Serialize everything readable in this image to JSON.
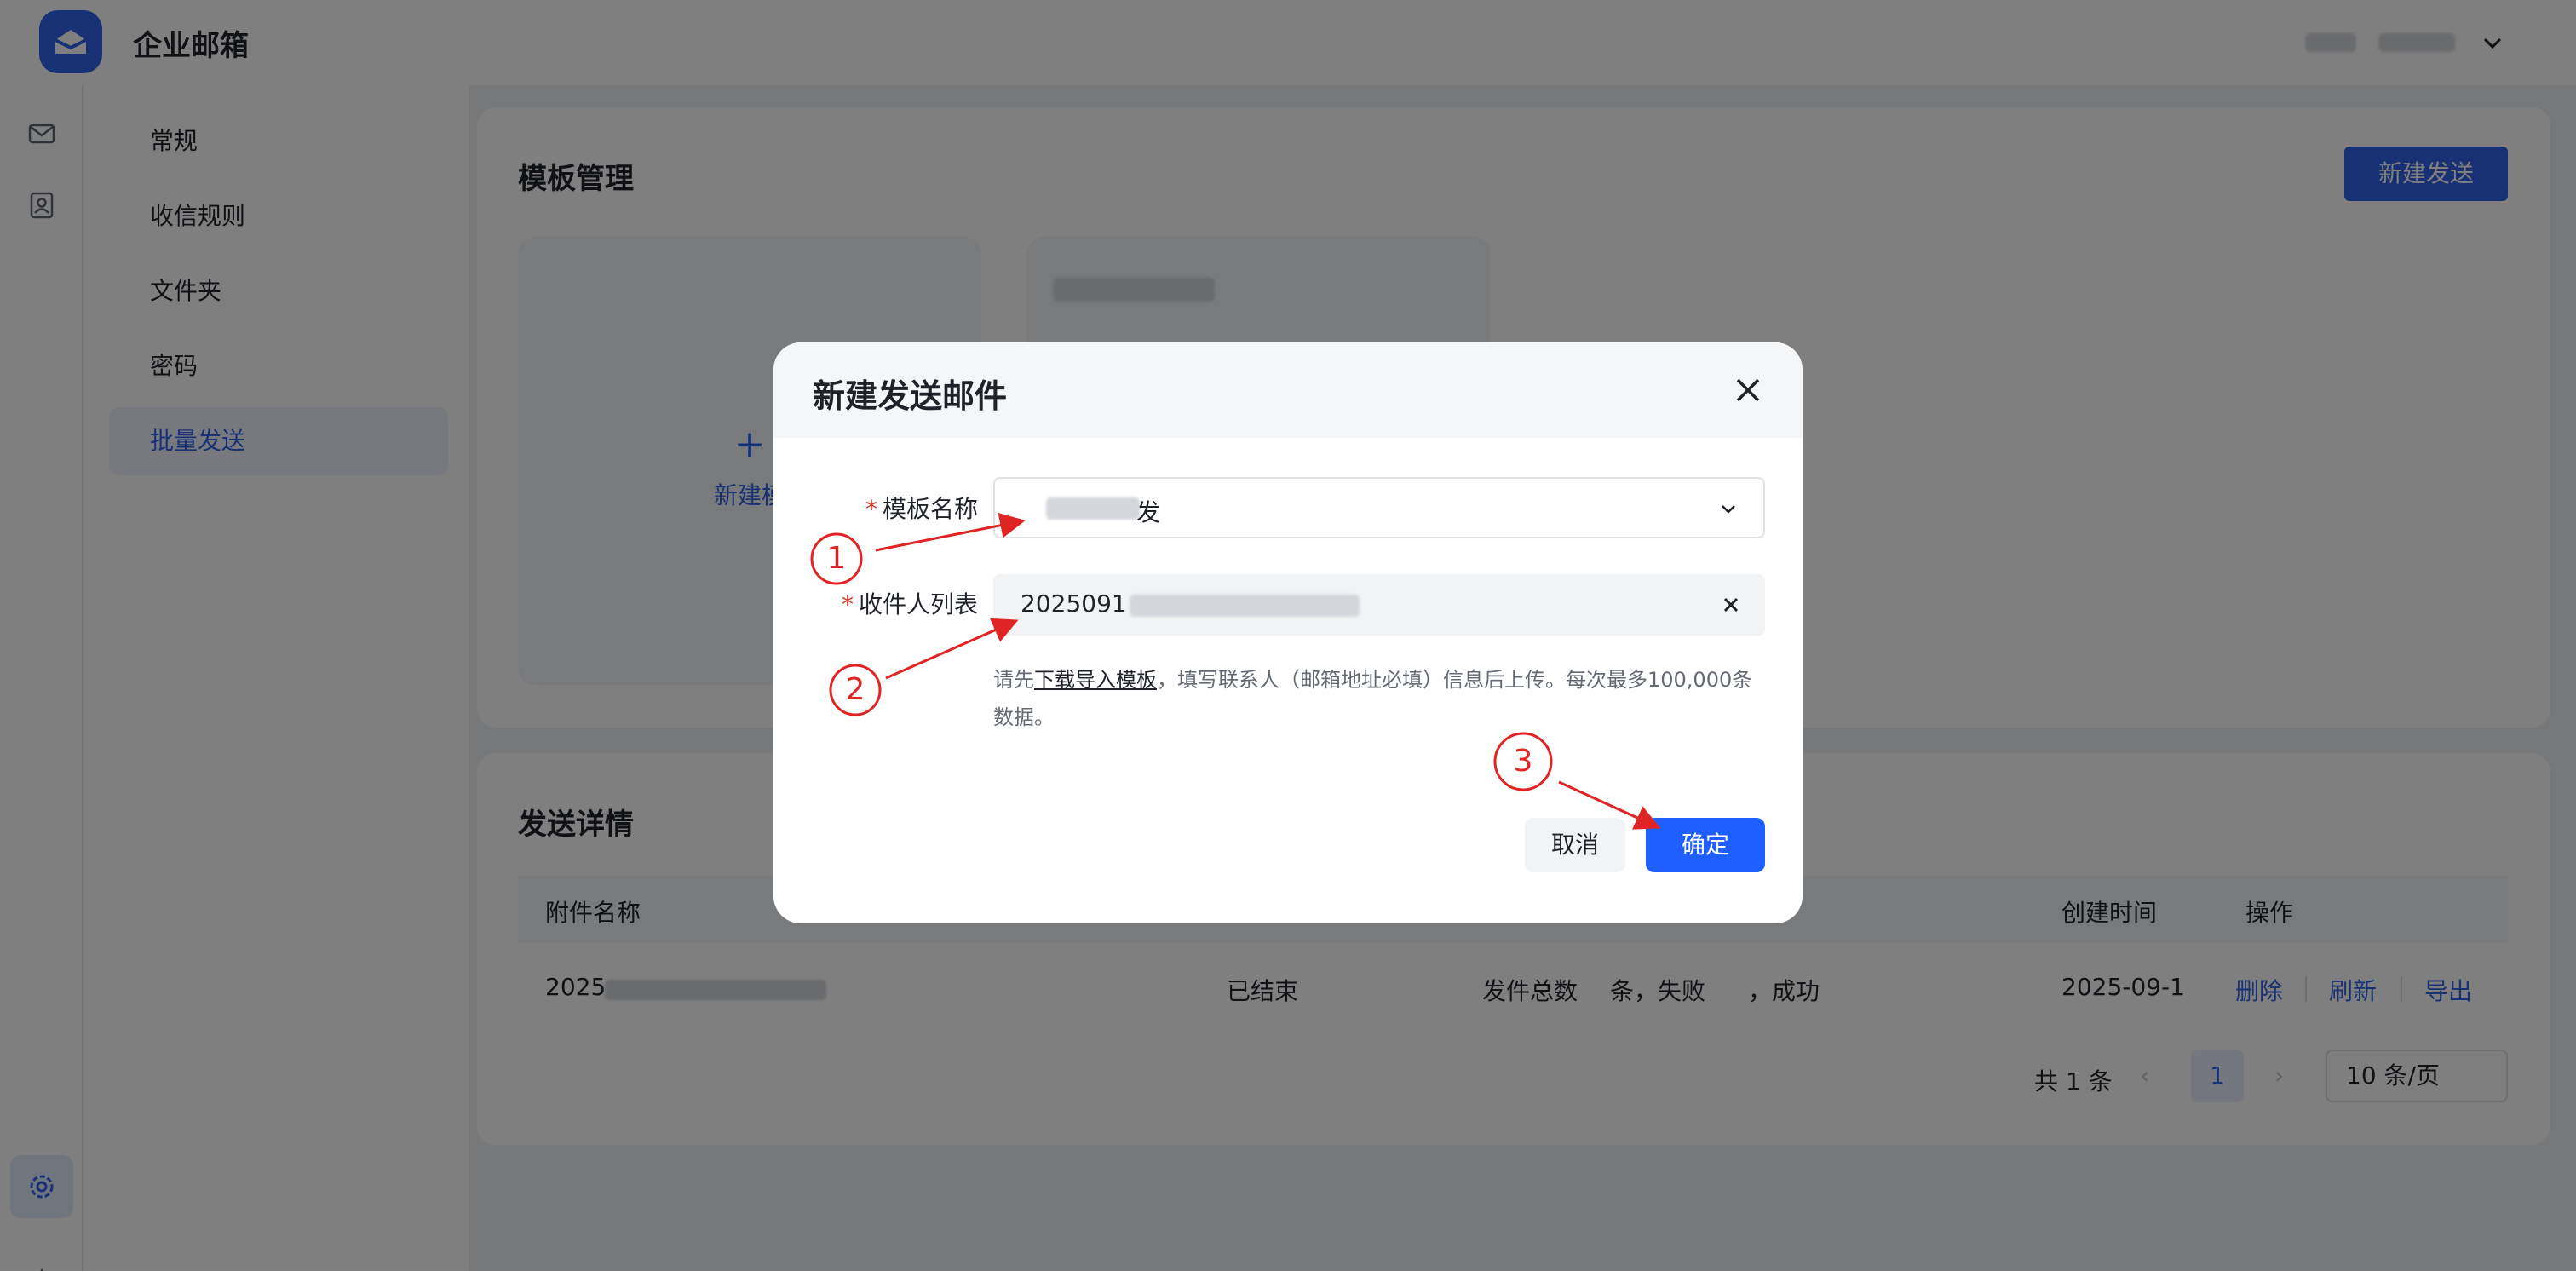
{
  "app": {
    "title": "企业邮箱"
  },
  "menu": {
    "items": [
      {
        "label": "常规"
      },
      {
        "label": "收信规则"
      },
      {
        "label": "文件夹"
      },
      {
        "label": "密码"
      },
      {
        "label": "批量发送",
        "active": true
      }
    ]
  },
  "templates": {
    "title": "模板管理",
    "new_send_button": "新建发送",
    "add_template_label": "新建模"
  },
  "details": {
    "title": "发送详情",
    "columns": [
      "附件名称",
      "创建时间",
      "操作"
    ],
    "row": {
      "attachment": "2025",
      "status": "已结束",
      "summary_a": "发件总数",
      "summary_b": "条，失败",
      "summary_c": "，成功",
      "created": "2025-09-1",
      "actions": [
        "删除",
        "刷新",
        "导出"
      ]
    },
    "pager": {
      "total": "共 1 条",
      "page": "1",
      "page_size": "10 条/页"
    }
  },
  "modal": {
    "title": "新建发送邮件",
    "template_label": "模板名称",
    "template_value_suffix": "发",
    "recipients_label": "收件人列表",
    "recipients_value": "2025091",
    "hint_before": "请先",
    "hint_link": "下载导入模板",
    "hint_after": "，填写联系人（邮箱地址必填）信息后上传。每次最多100,000条数据。",
    "cancel": "取消",
    "confirm": "确定"
  },
  "annotations": [
    "1",
    "2",
    "3"
  ],
  "colors": {
    "primary": "#1f5eff",
    "annotation": "#e02424"
  }
}
